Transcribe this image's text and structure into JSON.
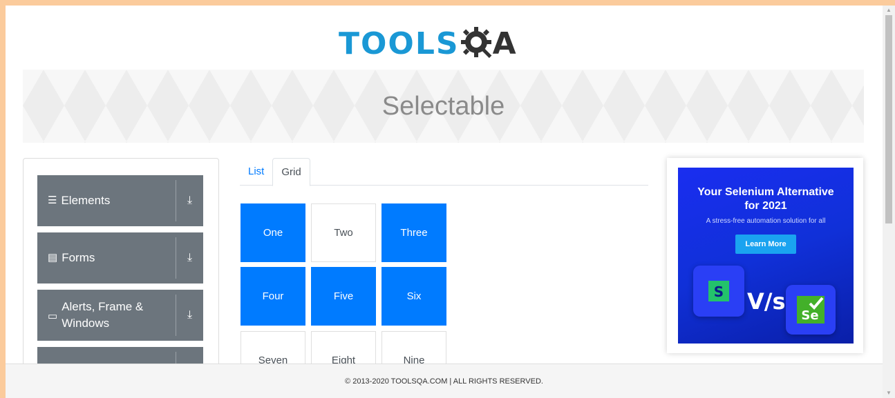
{
  "header": {
    "logo_text": "TOOLS",
    "logo_suffix": "A"
  },
  "banner": {
    "title": "Selectable"
  },
  "sidebar": {
    "groups": [
      {
        "label": "Elements",
        "icon": "hamburger-icon"
      },
      {
        "label": "Forms",
        "icon": "form-icon"
      },
      {
        "label_line1": "Alerts, Frame &",
        "label_line2": "Windows",
        "icon": "window-icon"
      },
      {
        "label": "",
        "icon": ""
      }
    ]
  },
  "tabs": [
    {
      "label": "List",
      "active": false
    },
    {
      "label": "Grid",
      "active": true
    }
  ],
  "grid": {
    "cells": [
      {
        "label": "One",
        "selected": true
      },
      {
        "label": "Two",
        "selected": false
      },
      {
        "label": "Three",
        "selected": true
      },
      {
        "label": "Four",
        "selected": true
      },
      {
        "label": "Five",
        "selected": true
      },
      {
        "label": "Six",
        "selected": true
      },
      {
        "label": "Seven",
        "selected": false
      },
      {
        "label": "Eight",
        "selected": false
      },
      {
        "label": "Nine",
        "selected": false
      }
    ]
  },
  "ad": {
    "title_line1": "Your Selenium Alternative",
    "title_line2": "for 2021",
    "subtitle": "A stress-free automation solution for all",
    "button": "Learn More",
    "vs": "V/s",
    "left_logo": "S",
    "right_logo": "Se"
  },
  "footer": {
    "text": "© 2013-2020 TOOLSQA.COM | ALL RIGHTS RESERVED."
  },
  "colors": {
    "accent": "#007bff",
    "sidebar_group": "#6c757d",
    "page_frame": "#fbcb9c",
    "logo_blue": "#1a98d5"
  }
}
